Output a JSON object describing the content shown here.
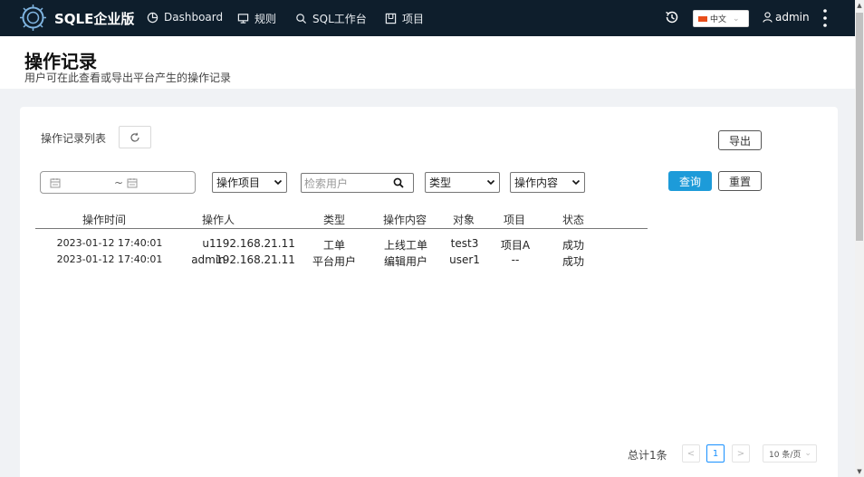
{
  "nav": {
    "brand": "SQLE企业版",
    "items": [
      {
        "label": "Dashboard",
        "icon": "pie-chart-icon"
      },
      {
        "label": "规则",
        "icon": "monitor-icon"
      },
      {
        "label": "SQL工作台",
        "icon": "search-icon"
      },
      {
        "label": "项目",
        "icon": "project-icon"
      }
    ],
    "language": "中文",
    "user": "admin",
    "colors": {
      "background": "#0e1e2c",
      "flag": "#e94e1b"
    }
  },
  "page": {
    "title": "操作记录",
    "subtitle": "用户可在此查看或导出平台产生的操作记录"
  },
  "toolbar": {
    "list_title": "操作记录列表",
    "export_label": "导出"
  },
  "filters": {
    "date_separator": "~",
    "project_select": "操作项目",
    "search_placeholder": "检索用户",
    "type_select": "类型",
    "content_select": "操作内容",
    "query_label": "查询",
    "reset_label": "重置",
    "accent": "#1d9bd9"
  },
  "table": {
    "headers": [
      "操作时间",
      "操作人",
      "类型",
      "操作内容",
      "对象",
      "项目",
      "状态"
    ],
    "rows": [
      {
        "time": "2023-01-12 17:40:01",
        "operator": "u1",
        "ip": "192.168.21.11",
        "type": "工单",
        "content": "上线工单",
        "object": "test3",
        "project": "项目A",
        "status": "成功"
      },
      {
        "time": "2023-01-12 17:40:01",
        "operator": "admin",
        "ip": "192.168.21.11",
        "type": "平台用户",
        "content": "编辑用户",
        "object": "user1",
        "project": "--",
        "status": "成功"
      }
    ]
  },
  "pagination": {
    "total": "总计1条",
    "prev": "<",
    "current_page": "1",
    "next": ">",
    "page_size": "10 条/页"
  }
}
